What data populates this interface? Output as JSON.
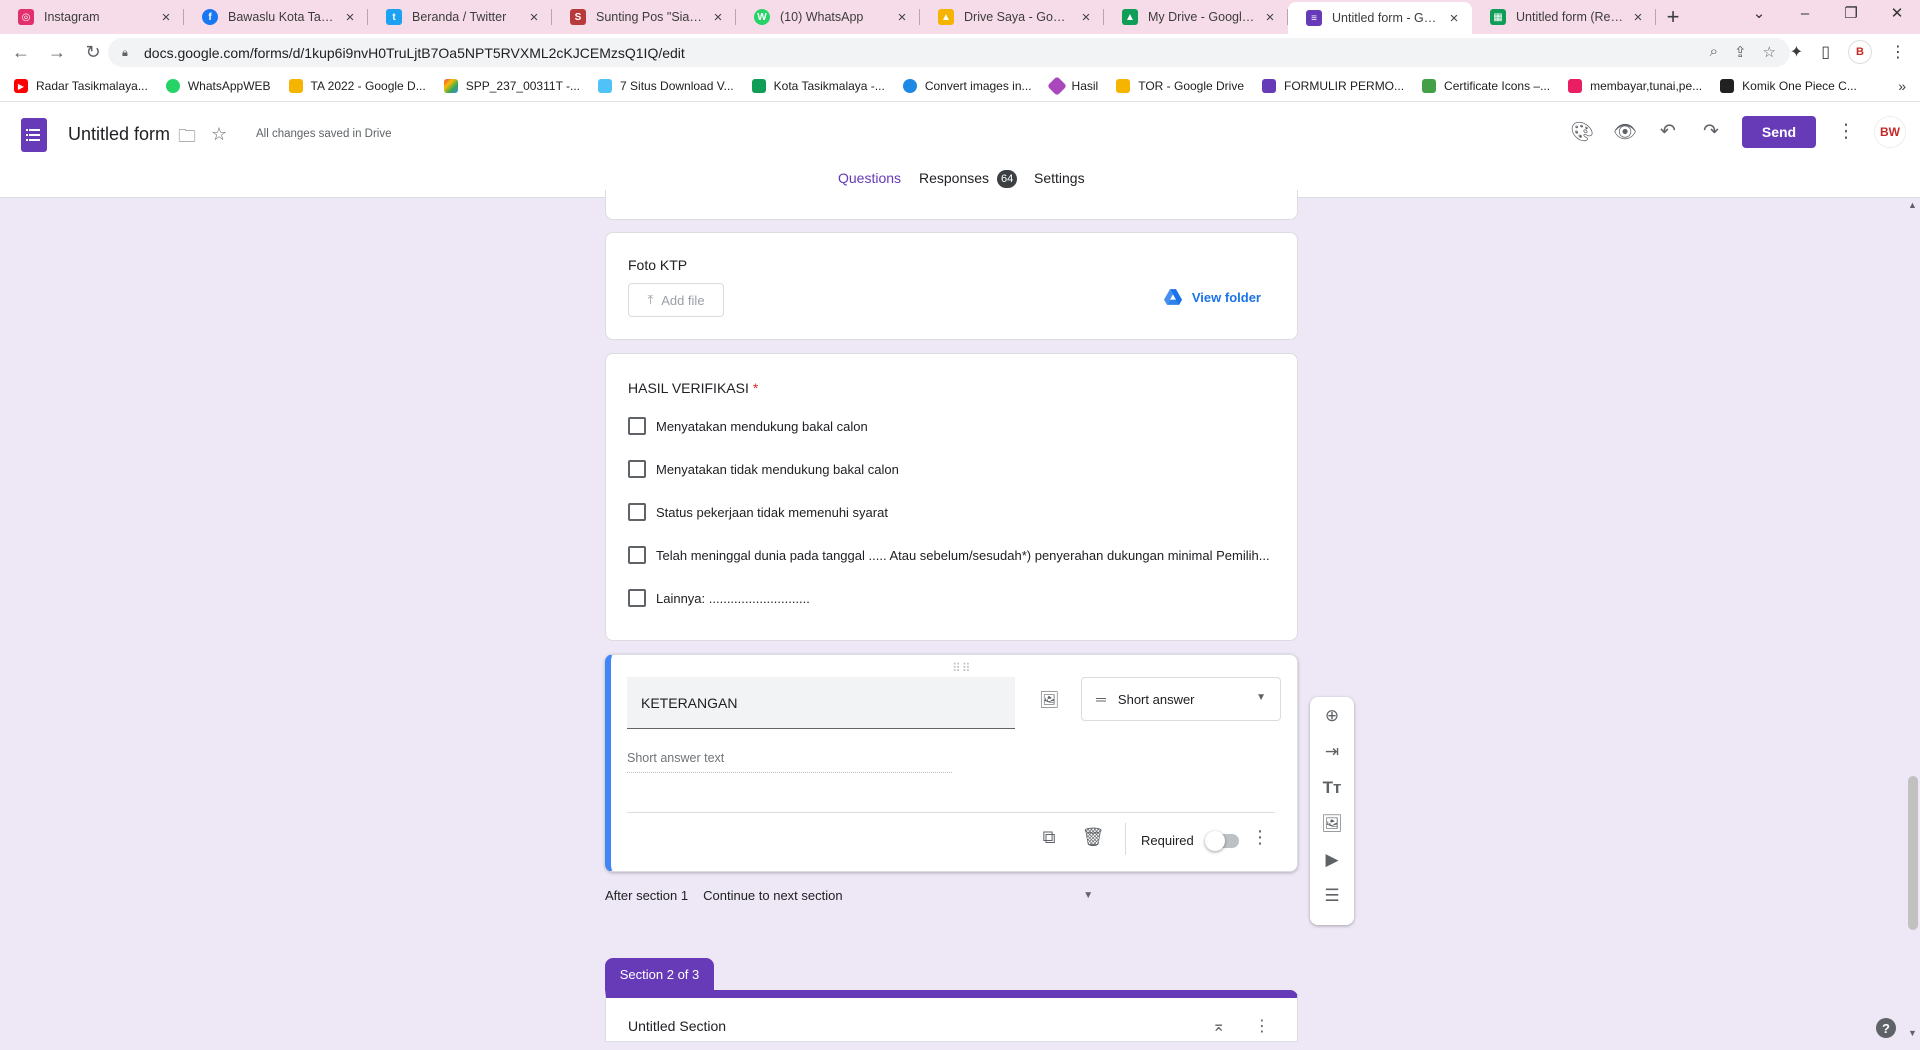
{
  "browser": {
    "tabs": [
      {
        "title": "Instagram",
        "color": "#e1306c",
        "glyph": "◎"
      },
      {
        "title": "Bawaslu Kota Tasikmalaya",
        "color": "#1877f2",
        "glyph": "f"
      },
      {
        "title": "Beranda / Twitter",
        "color": "#1da1f2",
        "glyph": "t"
      },
      {
        "title": "Sunting Pos \"Siaga Pemilu\"",
        "color": "#b83a3a",
        "glyph": "S"
      },
      {
        "title": "(10) WhatsApp",
        "color": "#25d366",
        "glyph": "W"
      },
      {
        "title": "Drive Saya - Google Drive",
        "color": "#f4b400",
        "glyph": "▲"
      },
      {
        "title": "My Drive - Google Drive",
        "color": "#0f9d58",
        "glyph": "▲"
      },
      {
        "title": "Untitled form - Google Forms",
        "color": "#673ab7",
        "glyph": "≡"
      },
      {
        "title": "Untitled form (Responses)",
        "color": "#0f9d58",
        "glyph": "▦"
      }
    ],
    "url": "docs.google.com/forms/d/1kup6i9nvH0TruLjtB7Oa5NPT5RVXML2cKJCEMzsQ1IQ/edit",
    "bookmarks": [
      {
        "label": "Radar Tasikmalaya...",
        "color": "#ff0000"
      },
      {
        "label": "WhatsAppWEB",
        "color": "#25d366"
      },
      {
        "label": "TA 2022 - Google D...",
        "color": "#f4b400"
      },
      {
        "label": "SPP_237_00311T -...",
        "color": "#4285f4"
      },
      {
        "label": "7 Situs Download V...",
        "color": "#4fc3f7"
      },
      {
        "label": "Kota Tasikmalaya -...",
        "color": "#0f9d58"
      },
      {
        "label": "Convert images in...",
        "color": "#1e88e5"
      },
      {
        "label": "Hasil",
        "color": "#ab47bc"
      },
      {
        "label": "TOR - Google Drive",
        "color": "#f4b400"
      },
      {
        "label": "FORMULIR PERMO...",
        "color": "#673ab7"
      },
      {
        "label": "Certificate Icons –...",
        "color": "#43a047"
      },
      {
        "label": "membayar,tunai,pe...",
        "color": "#e91e63"
      },
      {
        "label": "Komik One Piece C...",
        "color": "#212121"
      }
    ]
  },
  "header": {
    "title": "Untitled form",
    "saved_status": "All changes saved in Drive",
    "send_label": "Send",
    "account_initials": "BW"
  },
  "form_tabs": {
    "questions": "Questions",
    "responses": "Responses",
    "responses_count": "64",
    "settings": "Settings"
  },
  "questions": {
    "foto_ktp": {
      "title": "Foto KTP",
      "add_file": "Add file",
      "view_folder": "View folder"
    },
    "hasil": {
      "title": "HASIL VERIFIKASI",
      "required_mark": "*",
      "options": [
        "Menyatakan mendukung bakal calon",
        "Menyatakan tidak mendukung bakal calon",
        "Status pekerjaan tidak memenuhi syarat",
        "Telah meninggal dunia pada tanggal ..... Atau sebelum/sesudah*) penyerahan dukungan minimal Pemilih...",
        "Lainnya: ............................"
      ]
    },
    "keterangan": {
      "title": "KETERANGAN",
      "type": "Short answer",
      "placeholder": "Short answer text",
      "required_label": "Required",
      "required": false
    }
  },
  "section_nav": {
    "after_label": "After section 1",
    "after_value": "Continue to next section"
  },
  "section2": {
    "badge": "Section 2 of 3",
    "title": "Untitled Section"
  },
  "colors": {
    "accent": "#673ab7",
    "focus_bar": "#4285f4",
    "background": "#ede7f6"
  }
}
